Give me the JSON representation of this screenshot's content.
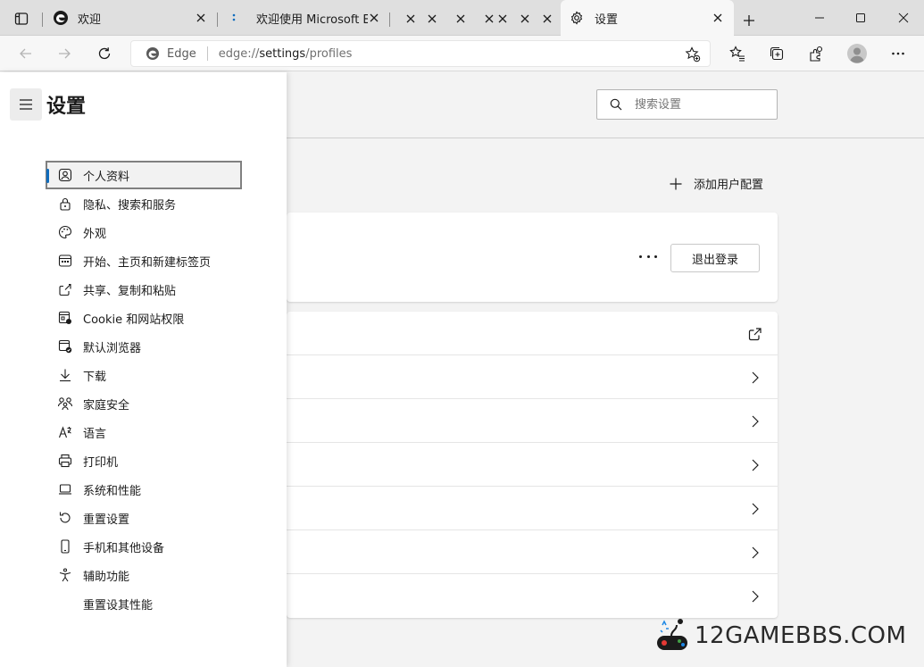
{
  "tabs": [
    {
      "title": "欢迎",
      "active": false
    },
    {
      "title": "欢迎使用 Microsoft Edge",
      "active": false
    },
    {
      "title": "设置",
      "active": true
    }
  ],
  "address_bar": {
    "badge": "Edge",
    "url_prefix": "edge://",
    "url_host": "settings",
    "url_path": "/profiles"
  },
  "search": {
    "placeholder": "搜索设置"
  },
  "drawer": {
    "title": "设置",
    "items": [
      {
        "label": "个人资料",
        "icon": "profile-icon",
        "active": true
      },
      {
        "label": "隐私、搜索和服务",
        "icon": "lock-icon"
      },
      {
        "label": "外观",
        "icon": "palette-icon"
      },
      {
        "label": "开始、主页和新建标签页",
        "icon": "home-grid-icon"
      },
      {
        "label": "共享、复制和粘贴",
        "icon": "share-icon"
      },
      {
        "label": "Cookie 和网站权限",
        "icon": "cookie-site-icon"
      },
      {
        "label": "默认浏览器",
        "icon": "default-browser-icon"
      },
      {
        "label": "下载",
        "icon": "download-icon"
      },
      {
        "label": "家庭安全",
        "icon": "family-icon"
      },
      {
        "label": "语言",
        "icon": "language-icon"
      },
      {
        "label": "打印机",
        "icon": "printer-icon"
      },
      {
        "label": "系统和性能",
        "icon": "laptop-icon"
      },
      {
        "label": "重置设置",
        "icon": "reset-icon"
      },
      {
        "label": "手机和其他设备",
        "icon": "phone-icon"
      },
      {
        "label": "辅助功能",
        "icon": "accessibility-icon"
      },
      {
        "label": "重置设其性能",
        "icon": ""
      }
    ]
  },
  "main": {
    "add_profile_label": "添加用户配置",
    "signout_label": "退出登录"
  },
  "watermark": "12GAMEBBS.COM"
}
